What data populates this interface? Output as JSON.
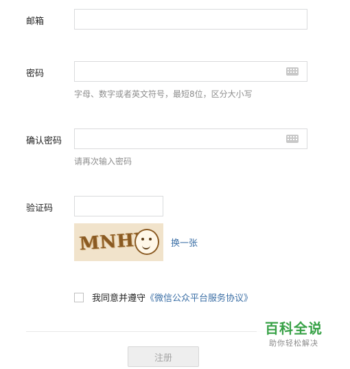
{
  "fields": {
    "email": {
      "label": "邮箱",
      "value": ""
    },
    "password": {
      "label": "密码",
      "value": "",
      "hint": "字母、数字或者英文符号，最短8位，区分大小写"
    },
    "confirm_password": {
      "label": "确认密码",
      "value": "",
      "hint": "请再次输入密码"
    },
    "captcha": {
      "label": "验证码",
      "value": "",
      "image_text": "MNHX",
      "refresh_label": "换一张"
    }
  },
  "agreement": {
    "checked": false,
    "prefix": "我同意并遵守",
    "link": "《微信公众平台服务协议》"
  },
  "submit_label": "注册",
  "watermark": {
    "title": "百科全说",
    "subtitle": "助你轻松解决"
  },
  "icons": {
    "keyboard": "keyboard-icon"
  },
  "colors": {
    "link": "#3a6ea5",
    "hint": "#8d8d8d",
    "brand_green": "#37a146"
  }
}
